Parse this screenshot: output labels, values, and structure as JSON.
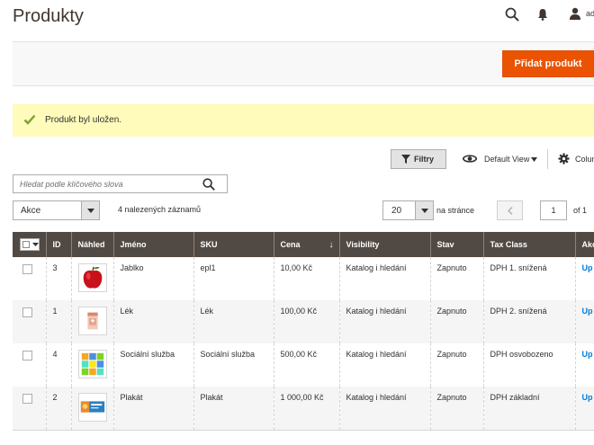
{
  "page": {
    "title": "Produkty"
  },
  "header": {
    "user_name": "ad"
  },
  "actions": {
    "add_product": "Přidat produkt"
  },
  "message": {
    "text": "Produkt byl uložen."
  },
  "toolbar": {
    "filters": "Filtry",
    "view": "Default View",
    "columns": "Colum"
  },
  "search": {
    "placeholder": "Hledat podle klíčového slova"
  },
  "mass_action": {
    "selected": "Akce"
  },
  "records": {
    "text": "4 nalezených záznamů"
  },
  "pagination": {
    "per_page": "20",
    "per_page_label": "na stránce",
    "current_page": "1",
    "of_total": "of 1"
  },
  "grid": {
    "columns": [
      "ID",
      "Náhled",
      "Jméno",
      "SKU",
      "Cena",
      "Visibility",
      "Stav",
      "Tax Class",
      "Akc"
    ],
    "sort_indicator": "↓",
    "rows": [
      {
        "id": "3",
        "thumb": "apple-thumbnail",
        "name": "Jablko",
        "sku": "epl1",
        "price": "10,00 Kč",
        "visibility": "Katalog i hledání",
        "status": "Zapnuto",
        "tax_class": "DPH 1. snížená",
        "action": "Up"
      },
      {
        "id": "1",
        "thumb": "medicine-thumbnail",
        "name": "Lék",
        "sku": "Lék",
        "price": "100,00 Kč",
        "visibility": "Katalog i hledání",
        "status": "Zapnuto",
        "tax_class": "DPH 2. snížená",
        "action": "Up"
      },
      {
        "id": "4",
        "thumb": "social-service-thumbnail",
        "name": "Sociální služba",
        "sku": "Sociální služba",
        "price": "500,00 Kč",
        "visibility": "Katalog i hledání",
        "status": "Zapnuto",
        "tax_class": "DPH osvobozeno",
        "action": "Up"
      },
      {
        "id": "2",
        "thumb": "poster-thumbnail",
        "name": "Plakát",
        "sku": "Plakát",
        "price": "1 000,00 Kč",
        "visibility": "Katalog i hledání",
        "status": "Zapnuto",
        "tax_class": "DPH základní",
        "action": "Up"
      }
    ]
  },
  "colors": {
    "accent": "#eb5202",
    "header_bg": "#514943",
    "message_bg": "#fffbbb",
    "success_check": "#79a22e",
    "link": "#007bdb"
  }
}
